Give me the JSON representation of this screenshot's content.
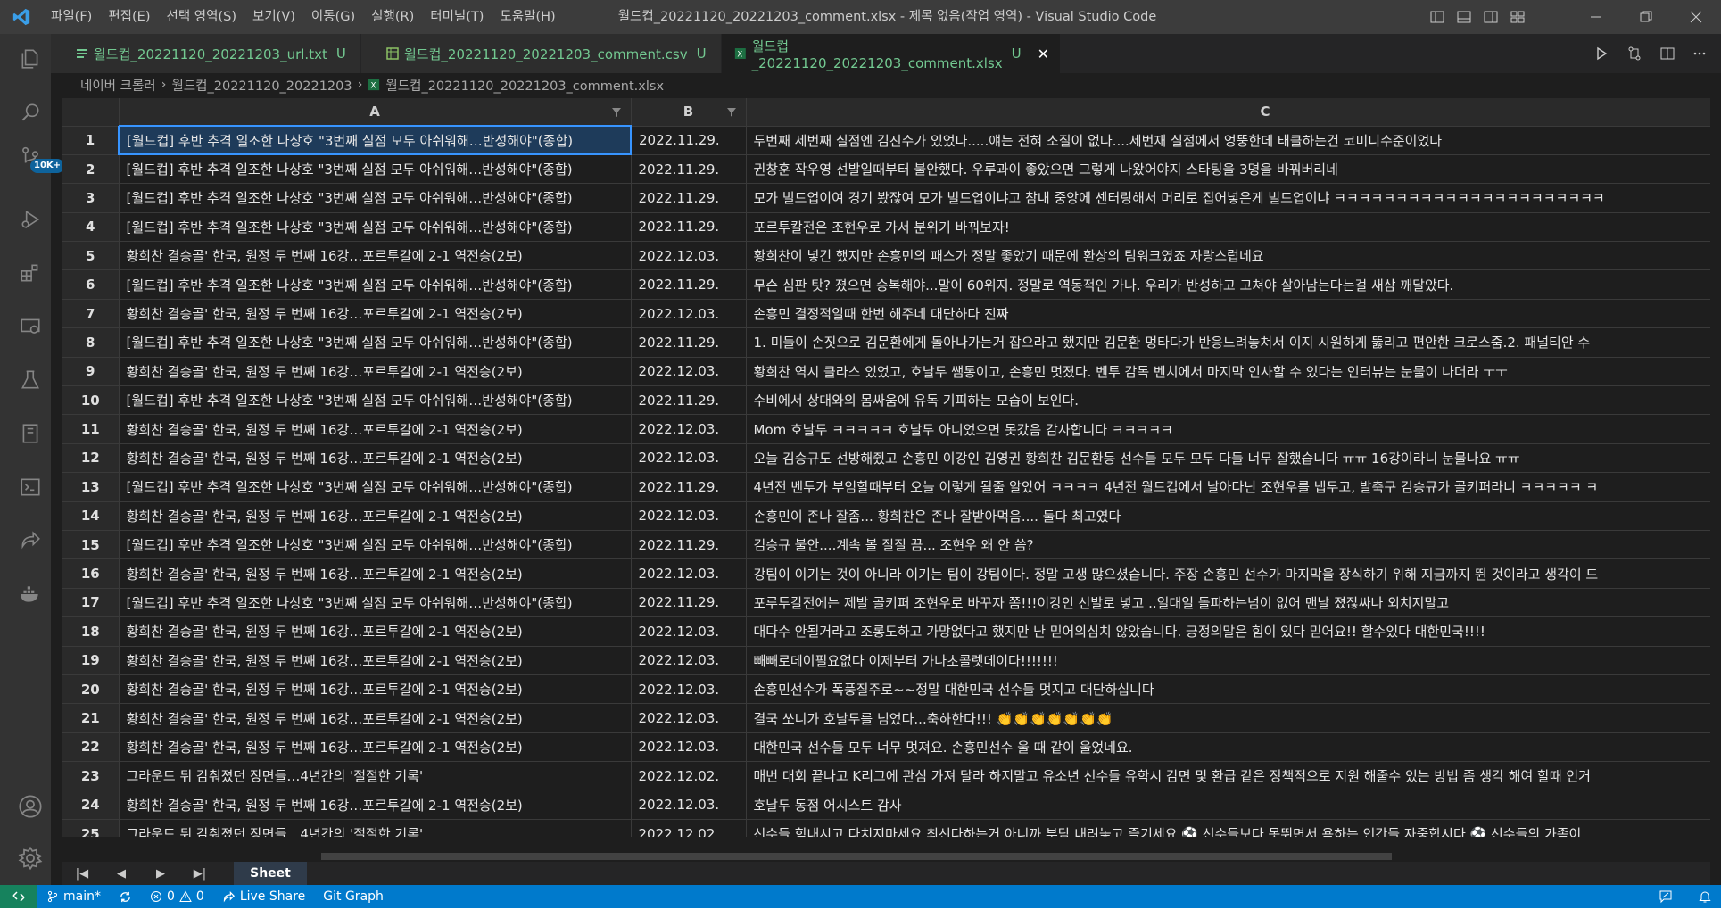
{
  "titlebar": {
    "menu": [
      "파일(F)",
      "편집(E)",
      "선택 영역(S)",
      "보기(V)",
      "이동(G)",
      "실행(R)",
      "터미널(T)",
      "도움말(H)"
    ],
    "title": "월드컵_20221120_20221203_comment.xlsx - 제목 없음(작업 영역) - Visual Studio Code"
  },
  "activity": {
    "badge": "10K+"
  },
  "tabs": [
    {
      "label": "월드컵_20221120_20221203_url.txt",
      "status": "U"
    },
    {
      "label": "월드컵_20221120_20221203_comment.csv",
      "status": "U"
    },
    {
      "label": "월드컵_20221120_20221203_comment.xlsx",
      "status": "U"
    }
  ],
  "breadcrumb": [
    "네이버 크롤러",
    "월드컵_20221120_20221203",
    "월드컵_20221120_20221203_comment.xlsx"
  ],
  "sheet": {
    "columns": [
      "A",
      "B",
      "C"
    ],
    "rows": [
      [
        "1",
        "[월드컵] 후반 추격 일조한 나상호 \"3번째 실점 모두 아쉬워해…반성해야\"(종합)",
        "2022.11.29.",
        "두번째 세번째 실점엔 김진수가 있었다.....얘는 전혀 소질이 없다....세번재 실점에서 엉뚱한데 태클하는건 코미디수준이었다"
      ],
      [
        "2",
        "[월드컵] 후반 추격 일조한 나상호 \"3번째 실점 모두 아쉬워해…반성해야\"(종합)",
        "2022.11.29.",
        "권창훈 작우영 선발일때부터 불안했다. 우루과이 좋았으면 그렇게 나왔어야지 스타팅을 3명을 바꿔버리네"
      ],
      [
        "3",
        "[월드컵] 후반 추격 일조한 나상호 \"3번째 실점 모두 아쉬워해…반성해야\"(종합)",
        "2022.11.29.",
        "모가 빌드업이여 경기 봤잖여 모가 빌드업이냐고 참내 중앙에 센터링해서 머리로 집어넣은게 빌드업이냐 ㅋㅋㅋㅋㅋㅋㅋㅋㅋㅋㅋㅋㅋㅋㅋㅋㅋㅋㅋㅋㅋㅋ"
      ],
      [
        "4",
        "[월드컵] 후반 추격 일조한 나상호 \"3번째 실점 모두 아쉬워해…반성해야\"(종합)",
        "2022.11.29.",
        "포르투칼전은 조현우로 가서 분위기 바꿔보자!"
      ],
      [
        "5",
        "황희찬 결승골' 한국, 원정 두 번째 16강…포르투갈에 2-1 역전승(2보)",
        "2022.12.03.",
        "황희찬이 넣긴 했지만 손흥민의 패스가 정말 좋았기 때문에 환상의 팀워크였죠 자랑스럽네요"
      ],
      [
        "6",
        "[월드컵] 후반 추격 일조한 나상호 \"3번째 실점 모두 아쉬워해…반성해야\"(종합)",
        "2022.11.29.",
        "무슨 심판 탓? 졌으면 승복해야...말이 60위지. 정말로 역동적인 가나. 우리가 반성하고 고쳐야 살아남는다는걸 새삼 깨달았다."
      ],
      [
        "7",
        "황희찬 결승골' 한국, 원정 두 번째 16강…포르투갈에 2-1 역전승(2보)",
        "2022.12.03.",
        "손흥민 결정적일때 한번 해주네 대단하다 진짜"
      ],
      [
        "8",
        "[월드컵] 후반 추격 일조한 나상호 \"3번째 실점 모두 아쉬워해…반성해야\"(종합)",
        "2022.11.29.",
        "1. 미들이 손짓으로 김문환에게 돌아나가는거 잡으라고 했지만 김문환 멍타다가 반응느려놓쳐서 이지 시원하게 뚫리고 편안한 크로스줌.2. 패널티안 수"
      ],
      [
        "9",
        "황희찬 결승골' 한국, 원정 두 번째 16강…포르투갈에 2-1 역전승(2보)",
        "2022.12.03.",
        "황희찬 역시 클라스 있었고, 호날두 쌤통이고, 손흥민 멋졌다. 벤투 감독 벤치에서 마지막 인사할 수 있다는 인터뷰는 눈물이 나더라 ㅜㅜ"
      ],
      [
        "10",
        "[월드컵] 후반 추격 일조한 나상호 \"3번째 실점 모두 아쉬워해…반성해야\"(종합)",
        "2022.11.29.",
        "수비에서 상대와의 몸싸움에 유독 기피하는 모습이 보인다."
      ],
      [
        "11",
        "황희찬 결승골' 한국, 원정 두 번째 16강…포르투갈에 2-1 역전승(2보)",
        "2022.12.03.",
        "Mom 호날두 ㅋㅋㅋㅋㅋ 호날두 아니었으면 못갔음 감사합니다 ㅋㅋㅋㅋㅋ"
      ],
      [
        "12",
        "황희찬 결승골' 한국, 원정 두 번째 16강…포르투갈에 2-1 역전승(2보)",
        "2022.12.03.",
        "오늘 김승규도 선방해줬고 손흥민 이강인 김영권 황희찬 김문환등 선수들 모두 모두 다들 너무 잘했습니다 ㅠㅠ 16강이라니 눈물나요 ㅠㅠ"
      ],
      [
        "13",
        "[월드컵] 후반 추격 일조한 나상호 \"3번째 실점 모두 아쉬워해…반성해야\"(종합)",
        "2022.11.29.",
        "4년전 벤투가 부임할때부터 오늘 이렇게 될줄 알았어 ㅋㅋㅋㅋ 4년전 월드컵에서 날아다닌 조현우를 냅두고, 발축구 김승규가 골키퍼라니 ㅋㅋㅋㅋㅋ ㅋ"
      ],
      [
        "14",
        "황희찬 결승골' 한국, 원정 두 번째 16강…포르투갈에 2-1 역전승(2보)",
        "2022.12.03.",
        "손흥민이 존나 잘좀... 황희찬은 존나 잘받아먹음.... 둘다 최고였다"
      ],
      [
        "15",
        "[월드컵] 후반 추격 일조한 나상호 \"3번째 실점 모두 아쉬워해…반성해야\"(종합)",
        "2022.11.29.",
        "김승규 불안....계속 볼 질질 끔... 조현우 왜 안 씀?"
      ],
      [
        "16",
        "황희찬 결승골' 한국, 원정 두 번째 16강…포르투갈에 2-1 역전승(2보)",
        "2022.12.03.",
        "강팀이 이기는 것이 아니라 이기는 팀이 강팀이다. 정말 고생 많으셨습니다. 주장 손흥민 선수가 마지막을 장식하기 위해 지금까지 뛴 것이라고 생각이 드"
      ],
      [
        "17",
        "[월드컵] 후반 추격 일조한 나상호 \"3번째 실점 모두 아쉬워해…반성해야\"(종합)",
        "2022.11.29.",
        "포루투칼전에는 제발 골키퍼 조현우로 바꾸자 쫌!!!이강인 선발로 넣고 ..일대일 돌파하는넘이 없어 맨날 졌잖싸나 외치지말고"
      ],
      [
        "18",
        "황희찬 결승골' 한국, 원정 두 번째 16강…포르투갈에 2-1 역전승(2보)",
        "2022.12.03.",
        "대다수 안될거라고 조롱도하고 가망없다고 했지만 난 믿어의심치 않았습니다. 긍정의말은 힘이 있다 믿어요!! 할수있다 대한민국!!!!"
      ],
      [
        "19",
        "황희찬 결승골' 한국, 원정 두 번째 16강…포르투갈에 2-1 역전승(2보)",
        "2022.12.03.",
        "빼빼로데이필요없다 이제부터 가나초콜렛데이다!!!!!!!"
      ],
      [
        "20",
        "황희찬 결승골' 한국, 원정 두 번째 16강…포르투갈에 2-1 역전승(2보)",
        "2022.12.03.",
        "손흥민선수가 폭풍질주로~~정말 대한민국 선수들 멋지고 대단하십니다"
      ],
      [
        "21",
        "황희찬 결승골' 한국, 원정 두 번째 16강…포르투갈에 2-1 역전승(2보)",
        "2022.12.03.",
        "결국 쏘니가 호날두를 넘었다...축하한다!!! 👏👏👏👏👏👏👏"
      ],
      [
        "22",
        "황희찬 결승골' 한국, 원정 두 번째 16강…포르투갈에 2-1 역전승(2보)",
        "2022.12.03.",
        "대한민국 선수들 모두 너무 멋져요. 손흥민선수 울 때 같이 울었네요."
      ],
      [
        "23",
        "그라운드 뒤 감춰졌던 장면들…4년간의 '절절한 기록'",
        "2022.12.02.",
        "매번 대회 끝나고 K리그에 관심 가져 달라 하지말고 유소년 선수들 유학시 감면 및 환급 같은 정책적으로 지원 해줄수 있는 방법 좀 생각 해여 할때 인거"
      ],
      [
        "24",
        "황희찬 결승골' 한국, 원정 두 번째 16강…포르투갈에 2-1 역전승(2보)",
        "2022.12.03.",
        "호날두 동점 어시스트 감사"
      ],
      [
        "25",
        "그라운드 뒤 감춰졌던 장면들…4년간의 '절절한 기록'",
        "2022.12.02.",
        "선수들 힘내시고 다치지마세요 최선다하는거 아니까 부담 내려놓고 즐기세요 ⚽ 선수들보다 못뛰면서 욕하는 인간들 자중합시다 ⚽ 선수들의 가족이"
      ]
    ],
    "sheet_tab": "Sheet"
  },
  "statusbar": {
    "branch": "main*",
    "errors": "0",
    "warnings": "0",
    "live_share": "Live Share",
    "git_graph": "Git Graph"
  }
}
